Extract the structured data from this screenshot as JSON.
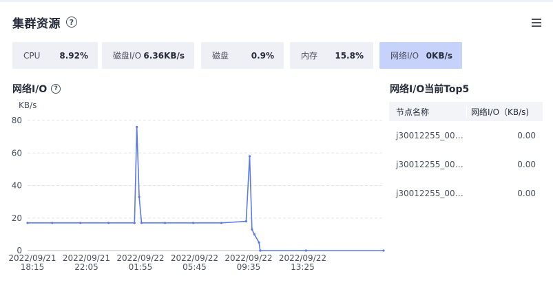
{
  "header": {
    "title": "集群资源",
    "help": "?"
  },
  "stats": [
    {
      "label": "CPU",
      "value": "8.92%"
    },
    {
      "label": "磁盘I/O",
      "value": "6.36KB/s"
    },
    {
      "label": "磁盘",
      "value": "0.9%"
    },
    {
      "label": "内存",
      "value": "15.8%"
    },
    {
      "label": "网络I/O",
      "value": "0KB/s"
    }
  ],
  "chart_section": {
    "title": "网络I/O",
    "help": "?",
    "unit": "KB/s"
  },
  "top5": {
    "title": "网络I/O当前Top5",
    "columns": [
      "节点名称",
      "网络I/O（KB/s)"
    ],
    "rows": [
      {
        "name": "j30012255_000...",
        "value": "0.00"
      },
      {
        "name": "j30012255_000...",
        "value": "0.00"
      },
      {
        "name": "j30012255_000...",
        "value": "0.00"
      }
    ]
  },
  "colors": {
    "accent": "#5b7ae6",
    "active_stat": "#c7d2fa",
    "stat_bg": "#eef0f6"
  },
  "chart_data": {
    "type": "line",
    "title": "网络I/O",
    "ylabel": "KB/s",
    "xlabel": "",
    "ylim": [
      0,
      80
    ],
    "yticks": [
      0,
      20,
      40,
      60,
      80
    ],
    "grid": true,
    "xlim": [
      "2022/09/21 18:15",
      "2022/09/22 19:30"
    ],
    "xticks": [
      {
        "t": "2022/09/21 18:15",
        "label": [
          "2022/09/21",
          "18:15"
        ]
      },
      {
        "t": "2022/09/21 22:05",
        "label": [
          "2022/09/21",
          "22:05"
        ]
      },
      {
        "t": "2022/09/22 01:55",
        "label": [
          "2022/09/22",
          "01:55"
        ]
      },
      {
        "t": "2022/09/22 05:45",
        "label": [
          "2022/09/22",
          "05:45"
        ]
      },
      {
        "t": "2022/09/22 09:35",
        "label": [
          "2022/09/22",
          "09:35"
        ]
      },
      {
        "t": "2022/09/22 13:25",
        "label": [
          "2022/09/22",
          "13:25"
        ]
      }
    ],
    "series": [
      {
        "points": [
          [
            "2022/09/21 18:15",
            17
          ],
          [
            "2022/09/21 20:00",
            17
          ],
          [
            "2022/09/21 22:00",
            17
          ],
          [
            "2022/09/22 00:00",
            17
          ],
          [
            "2022/09/22 01:50",
            17
          ],
          [
            "2022/09/22 02:00",
            76
          ],
          [
            "2022/09/22 02:10",
            33
          ],
          [
            "2022/09/22 02:20",
            17
          ],
          [
            "2022/09/22 04:00",
            17
          ],
          [
            "2022/09/22 06:00",
            17
          ],
          [
            "2022/09/22 08:00",
            17
          ],
          [
            "2022/09/22 09:45",
            18
          ],
          [
            "2022/09/22 10:00",
            58
          ],
          [
            "2022/09/22 10:10",
            13
          ],
          [
            "2022/09/22 10:20",
            10
          ],
          [
            "2022/09/22 10:40",
            5
          ],
          [
            "2022/09/22 10:45",
            0
          ],
          [
            "2022/09/22 14:00",
            0
          ],
          [
            "2022/09/22 19:30",
            0
          ]
        ]
      }
    ]
  }
}
